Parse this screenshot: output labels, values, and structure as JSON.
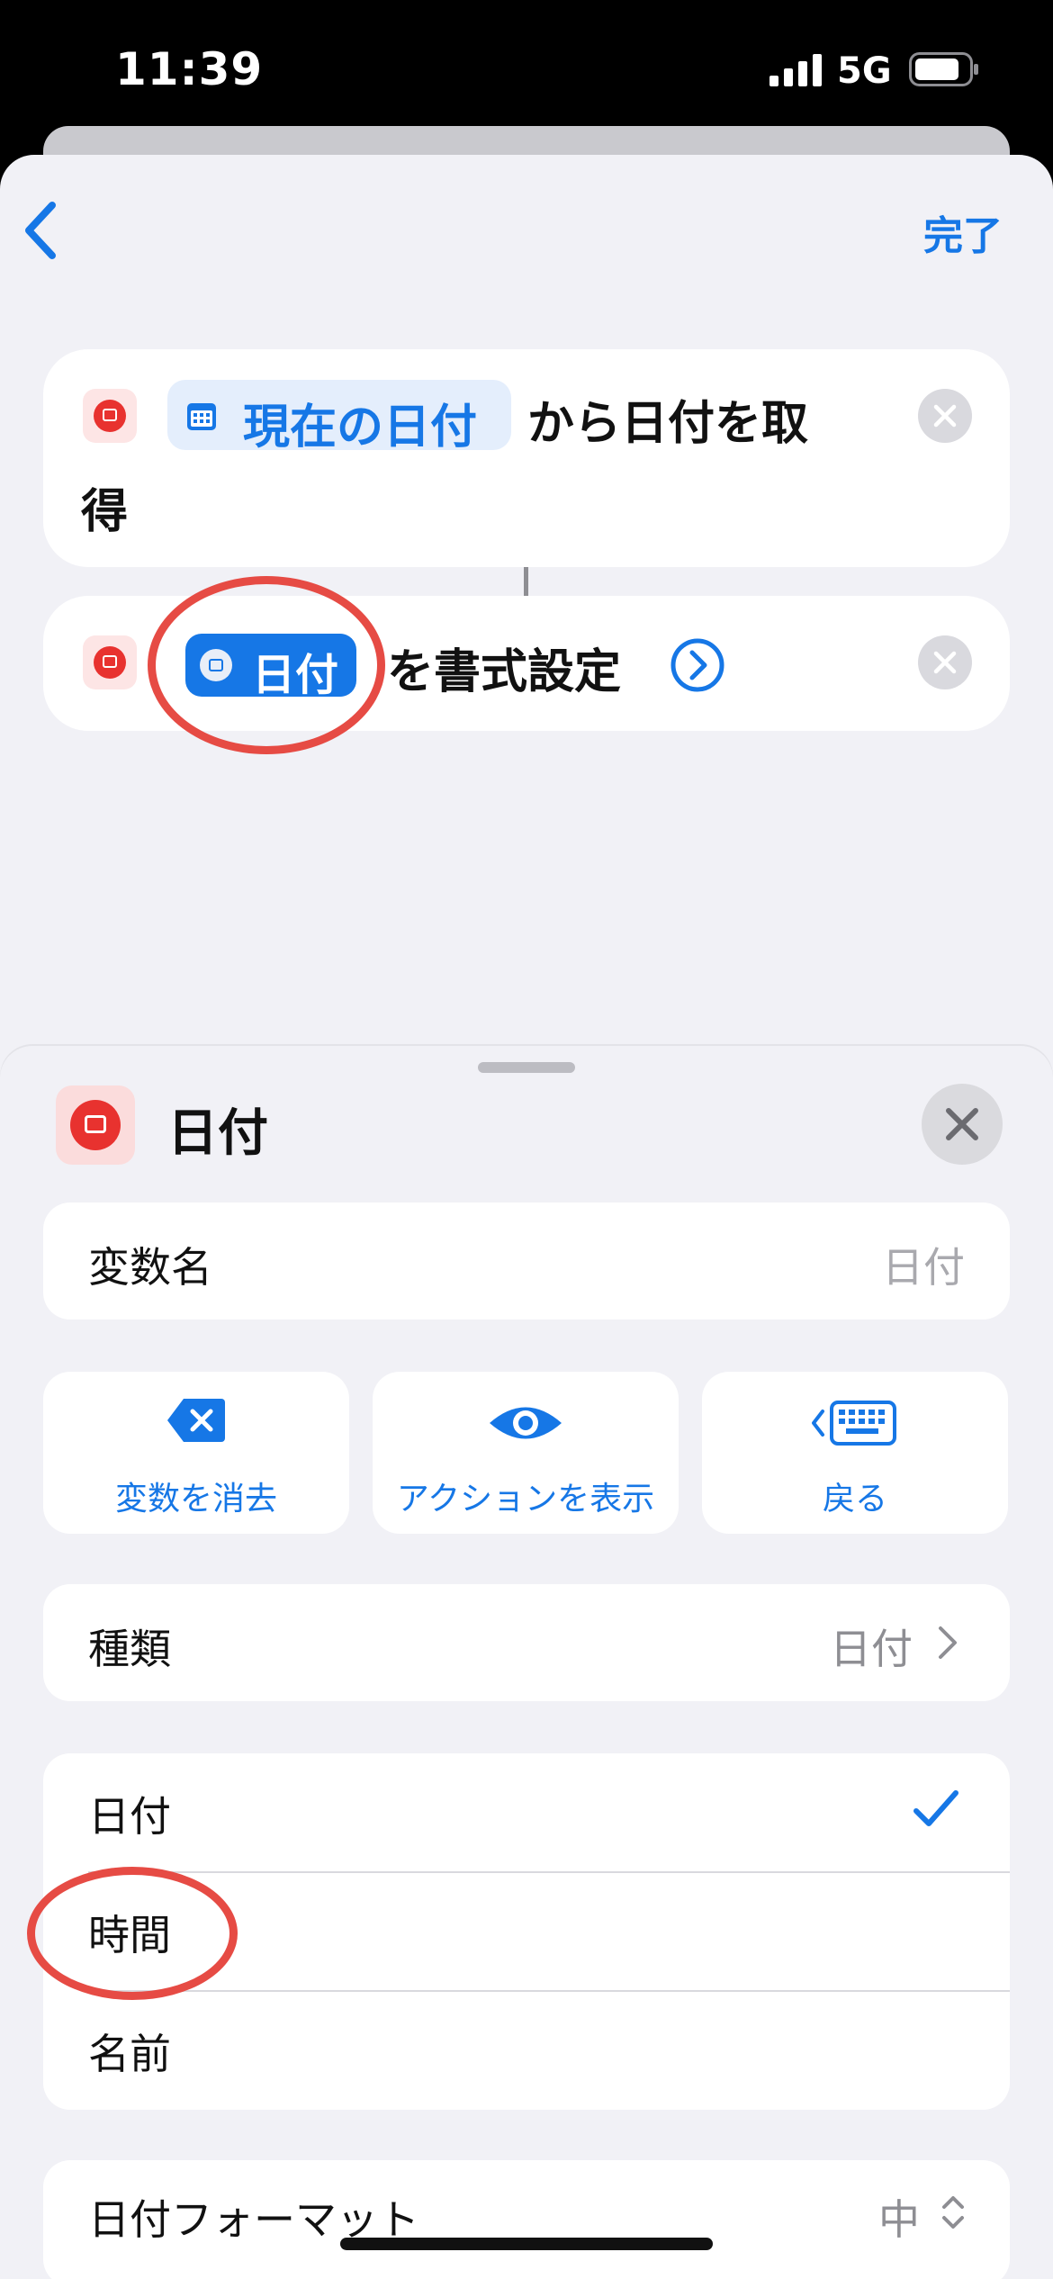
{
  "status_bar": {
    "time": "11:39",
    "network": "5G"
  },
  "nav": {
    "done_label": "完了"
  },
  "actions": {
    "action1": {
      "variable_chip": "現在の日付",
      "text_line1": "から日付を取",
      "text_line2": "得"
    },
    "action2": {
      "variable_chip": "日付",
      "text": "を書式設定"
    }
  },
  "sheet": {
    "title": "日付",
    "variable_name_label": "変数名",
    "variable_name_placeholder": "日付",
    "buttons": [
      {
        "label": "変数を消去",
        "icon": "delete-icon"
      },
      {
        "label": "アクションを表示",
        "icon": "eye-icon"
      },
      {
        "label": "戻る",
        "icon": "keyboard-back-icon"
      }
    ],
    "type_row": {
      "label": "種類",
      "value": "日付"
    },
    "options": [
      {
        "label": "日付",
        "selected": true
      },
      {
        "label": "時間",
        "selected": false
      },
      {
        "label": "名前",
        "selected": false
      }
    ],
    "format_row": {
      "label": "日付フォーマット",
      "value": "中"
    }
  },
  "colors": {
    "accent": "#1677e6",
    "app_red": "#e8322f",
    "annotation": "#e64b44"
  }
}
